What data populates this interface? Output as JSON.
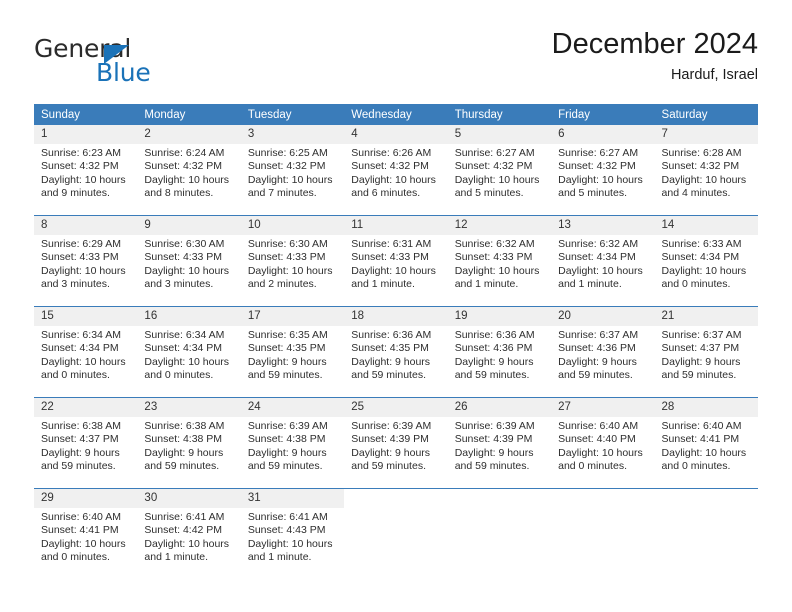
{
  "brand": {
    "name_top": "General",
    "name_bottom": "Blue",
    "accent_color": "#1a72b8"
  },
  "header": {
    "title": "December 2024",
    "subtitle": "Harduf, Israel",
    "header_bg_color": "#3a7cba",
    "daynum_bg_color": "#f0f0f0"
  },
  "weekday_headers": [
    "Sunday",
    "Monday",
    "Tuesday",
    "Wednesday",
    "Thursday",
    "Friday",
    "Saturday"
  ],
  "weeks": [
    [
      {
        "day": "1",
        "sunrise": "Sunrise: 6:23 AM",
        "sunset": "Sunset: 4:32 PM",
        "daylight_line1": "Daylight: 10 hours",
        "daylight_line2": "and 9 minutes."
      },
      {
        "day": "2",
        "sunrise": "Sunrise: 6:24 AM",
        "sunset": "Sunset: 4:32 PM",
        "daylight_line1": "Daylight: 10 hours",
        "daylight_line2": "and 8 minutes."
      },
      {
        "day": "3",
        "sunrise": "Sunrise: 6:25 AM",
        "sunset": "Sunset: 4:32 PM",
        "daylight_line1": "Daylight: 10 hours",
        "daylight_line2": "and 7 minutes."
      },
      {
        "day": "4",
        "sunrise": "Sunrise: 6:26 AM",
        "sunset": "Sunset: 4:32 PM",
        "daylight_line1": "Daylight: 10 hours",
        "daylight_line2": "and 6 minutes."
      },
      {
        "day": "5",
        "sunrise": "Sunrise: 6:27 AM",
        "sunset": "Sunset: 4:32 PM",
        "daylight_line1": "Daylight: 10 hours",
        "daylight_line2": "and 5 minutes."
      },
      {
        "day": "6",
        "sunrise": "Sunrise: 6:27 AM",
        "sunset": "Sunset: 4:32 PM",
        "daylight_line1": "Daylight: 10 hours",
        "daylight_line2": "and 5 minutes."
      },
      {
        "day": "7",
        "sunrise": "Sunrise: 6:28 AM",
        "sunset": "Sunset: 4:32 PM",
        "daylight_line1": "Daylight: 10 hours",
        "daylight_line2": "and 4 minutes."
      }
    ],
    [
      {
        "day": "8",
        "sunrise": "Sunrise: 6:29 AM",
        "sunset": "Sunset: 4:33 PM",
        "daylight_line1": "Daylight: 10 hours",
        "daylight_line2": "and 3 minutes."
      },
      {
        "day": "9",
        "sunrise": "Sunrise: 6:30 AM",
        "sunset": "Sunset: 4:33 PM",
        "daylight_line1": "Daylight: 10 hours",
        "daylight_line2": "and 3 minutes."
      },
      {
        "day": "10",
        "sunrise": "Sunrise: 6:30 AM",
        "sunset": "Sunset: 4:33 PM",
        "daylight_line1": "Daylight: 10 hours",
        "daylight_line2": "and 2 minutes."
      },
      {
        "day": "11",
        "sunrise": "Sunrise: 6:31 AM",
        "sunset": "Sunset: 4:33 PM",
        "daylight_line1": "Daylight: 10 hours",
        "daylight_line2": "and 1 minute."
      },
      {
        "day": "12",
        "sunrise": "Sunrise: 6:32 AM",
        "sunset": "Sunset: 4:33 PM",
        "daylight_line1": "Daylight: 10 hours",
        "daylight_line2": "and 1 minute."
      },
      {
        "day": "13",
        "sunrise": "Sunrise: 6:32 AM",
        "sunset": "Sunset: 4:34 PM",
        "daylight_line1": "Daylight: 10 hours",
        "daylight_line2": "and 1 minute."
      },
      {
        "day": "14",
        "sunrise": "Sunrise: 6:33 AM",
        "sunset": "Sunset: 4:34 PM",
        "daylight_line1": "Daylight: 10 hours",
        "daylight_line2": "and 0 minutes."
      }
    ],
    [
      {
        "day": "15",
        "sunrise": "Sunrise: 6:34 AM",
        "sunset": "Sunset: 4:34 PM",
        "daylight_line1": "Daylight: 10 hours",
        "daylight_line2": "and 0 minutes."
      },
      {
        "day": "16",
        "sunrise": "Sunrise: 6:34 AM",
        "sunset": "Sunset: 4:34 PM",
        "daylight_line1": "Daylight: 10 hours",
        "daylight_line2": "and 0 minutes."
      },
      {
        "day": "17",
        "sunrise": "Sunrise: 6:35 AM",
        "sunset": "Sunset: 4:35 PM",
        "daylight_line1": "Daylight: 9 hours",
        "daylight_line2": "and 59 minutes."
      },
      {
        "day": "18",
        "sunrise": "Sunrise: 6:36 AM",
        "sunset": "Sunset: 4:35 PM",
        "daylight_line1": "Daylight: 9 hours",
        "daylight_line2": "and 59 minutes."
      },
      {
        "day": "19",
        "sunrise": "Sunrise: 6:36 AM",
        "sunset": "Sunset: 4:36 PM",
        "daylight_line1": "Daylight: 9 hours",
        "daylight_line2": "and 59 minutes."
      },
      {
        "day": "20",
        "sunrise": "Sunrise: 6:37 AM",
        "sunset": "Sunset: 4:36 PM",
        "daylight_line1": "Daylight: 9 hours",
        "daylight_line2": "and 59 minutes."
      },
      {
        "day": "21",
        "sunrise": "Sunrise: 6:37 AM",
        "sunset": "Sunset: 4:37 PM",
        "daylight_line1": "Daylight: 9 hours",
        "daylight_line2": "and 59 minutes."
      }
    ],
    [
      {
        "day": "22",
        "sunrise": "Sunrise: 6:38 AM",
        "sunset": "Sunset: 4:37 PM",
        "daylight_line1": "Daylight: 9 hours",
        "daylight_line2": "and 59 minutes."
      },
      {
        "day": "23",
        "sunrise": "Sunrise: 6:38 AM",
        "sunset": "Sunset: 4:38 PM",
        "daylight_line1": "Daylight: 9 hours",
        "daylight_line2": "and 59 minutes."
      },
      {
        "day": "24",
        "sunrise": "Sunrise: 6:39 AM",
        "sunset": "Sunset: 4:38 PM",
        "daylight_line1": "Daylight: 9 hours",
        "daylight_line2": "and 59 minutes."
      },
      {
        "day": "25",
        "sunrise": "Sunrise: 6:39 AM",
        "sunset": "Sunset: 4:39 PM",
        "daylight_line1": "Daylight: 9 hours",
        "daylight_line2": "and 59 minutes."
      },
      {
        "day": "26",
        "sunrise": "Sunrise: 6:39 AM",
        "sunset": "Sunset: 4:39 PM",
        "daylight_line1": "Daylight: 9 hours",
        "daylight_line2": "and 59 minutes."
      },
      {
        "day": "27",
        "sunrise": "Sunrise: 6:40 AM",
        "sunset": "Sunset: 4:40 PM",
        "daylight_line1": "Daylight: 10 hours",
        "daylight_line2": "and 0 minutes."
      },
      {
        "day": "28",
        "sunrise": "Sunrise: 6:40 AM",
        "sunset": "Sunset: 4:41 PM",
        "daylight_line1": "Daylight: 10 hours",
        "daylight_line2": "and 0 minutes."
      }
    ],
    [
      {
        "day": "29",
        "sunrise": "Sunrise: 6:40 AM",
        "sunset": "Sunset: 4:41 PM",
        "daylight_line1": "Daylight: 10 hours",
        "daylight_line2": "and 0 minutes."
      },
      {
        "day": "30",
        "sunrise": "Sunrise: 6:41 AM",
        "sunset": "Sunset: 4:42 PM",
        "daylight_line1": "Daylight: 10 hours",
        "daylight_line2": "and 1 minute."
      },
      {
        "day": "31",
        "sunrise": "Sunrise: 6:41 AM",
        "sunset": "Sunset: 4:43 PM",
        "daylight_line1": "Daylight: 10 hours",
        "daylight_line2": "and 1 minute."
      },
      {
        "day": "",
        "sunrise": "",
        "sunset": "",
        "daylight_line1": "",
        "daylight_line2": ""
      },
      {
        "day": "",
        "sunrise": "",
        "sunset": "",
        "daylight_line1": "",
        "daylight_line2": ""
      },
      {
        "day": "",
        "sunrise": "",
        "sunset": "",
        "daylight_line1": "",
        "daylight_line2": ""
      },
      {
        "day": "",
        "sunrise": "",
        "sunset": "",
        "daylight_line1": "",
        "daylight_line2": ""
      }
    ]
  ]
}
